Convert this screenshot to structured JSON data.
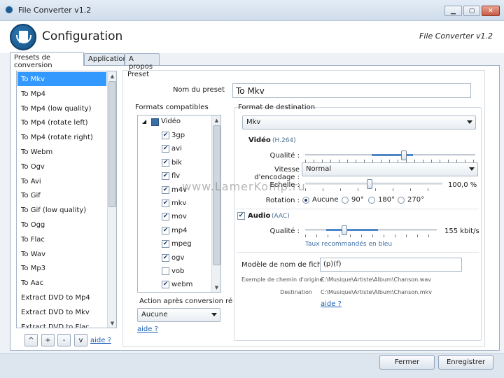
{
  "window": {
    "title": "File Converter v1.2",
    "min": "▁",
    "max": "▢",
    "close": "✕"
  },
  "header": {
    "title": "Configuration",
    "app_name": "File Converter v1.2"
  },
  "tabs": [
    "Presets de conversion",
    "Application",
    "A propos"
  ],
  "presets": [
    "To Mkv",
    "To Mp4",
    "To Mp4 (low quality)",
    "To Mp4 (rotate left)",
    "To Mp4 (rotate right)",
    "To Webm",
    "To Ogv",
    "To Avi",
    "To Gif",
    "To Gif (low quality)",
    "To Ogg",
    "To Flac",
    "To Wav",
    "To Mp3",
    "To Aac",
    "Extract DVD to Mp4",
    "Extract DVD to Mkv",
    "Extract DVD to Flac"
  ],
  "selected_preset_index": 0,
  "list_buttons": {
    "up": "^",
    "add": "+",
    "remove": "-",
    "down": "v",
    "help": "aide ?"
  },
  "preset": {
    "group_label": "Preset",
    "name_label": "Nom du preset",
    "name_value": "To Mkv",
    "compat_label": "Formats compatibles",
    "tree_root": "Vidéo",
    "formats": [
      {
        "name": "3gp",
        "checked": true
      },
      {
        "name": "avi",
        "checked": true
      },
      {
        "name": "bik",
        "checked": true
      },
      {
        "name": "flv",
        "checked": true
      },
      {
        "name": "m4v",
        "checked": true
      },
      {
        "name": "mkv",
        "checked": true
      },
      {
        "name": "mov",
        "checked": true
      },
      {
        "name": "mp4",
        "checked": true
      },
      {
        "name": "mpeg",
        "checked": true
      },
      {
        "name": "ogv",
        "checked": true
      },
      {
        "name": "vob",
        "checked": false
      },
      {
        "name": "webm",
        "checked": true
      }
    ],
    "after_label": "Action après conversion ré",
    "after_value": "Aucune",
    "help": "aide ?"
  },
  "dest": {
    "label": "Format de destination",
    "format_value": "Mkv",
    "video_label": "Vidéo",
    "video_codec": "(H.264)",
    "quality_label": "Qualité :",
    "quality_level": 0.58,
    "speed_label": "Vitesse d'encodage :",
    "speed_value": "Normal",
    "scale_label": "Echelle :",
    "scale_value": "100,0 %",
    "scale_level": 0.47,
    "rotation_label": "Rotation :",
    "rotations": [
      "Aucune",
      "90°",
      "180°",
      "270°"
    ],
    "rotation_selected": 0,
    "audio_label": "Audio",
    "audio_codec": "(AAC)",
    "audio_checked": true,
    "audio_quality_label": "Qualité :",
    "audio_quality_value": "155 kbit/s",
    "audio_level": 0.3,
    "recommend_text": "Taux recommandés en bleu",
    "template_label": "Modèle de nom de fichi",
    "template_value": "(p)(f)",
    "example_label": "Exemple de chemin d'origine",
    "example_value": "C:\\Musique\\Artiste\\Album\\Chanson.wav",
    "dest_label": "Destination",
    "dest_value": "C:\\Musique\\Artiste\\Album\\Chanson.mkv",
    "help": "aide ?"
  },
  "footer": {
    "close": "Fermer",
    "save": "Enregistrer"
  },
  "watermark": "www.LamerKomp.ru",
  "colors": {
    "selection": "#3399ff",
    "link": "#1a5fb4",
    "slider_blue": "#4f86c6"
  }
}
